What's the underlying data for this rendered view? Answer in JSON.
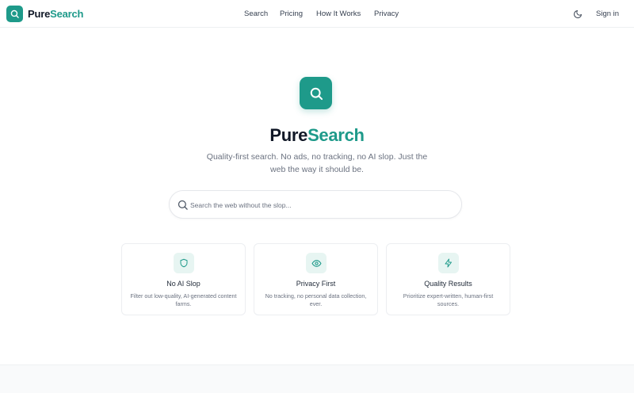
{
  "header": {
    "brand": {
      "pure": "Pure",
      "search": "Search"
    },
    "nav": [
      "Search",
      "Pricing",
      "How It Works",
      "Privacy"
    ],
    "signin_label": "Sign in",
    "theme_icon": "moon-icon"
  },
  "hero": {
    "title_pure": "Pure",
    "title_search": "Search",
    "subtitle": "Quality-first search. No ads, no tracking, no AI slop. Just the web the way it should be.",
    "icon": "search-icon"
  },
  "search": {
    "placeholder": "Search the web without the slop...",
    "value": ""
  },
  "features": [
    {
      "icon": "shield-icon",
      "title": "No AI Slop",
      "desc": "Filter out low-quality, AI-generated content farms."
    },
    {
      "icon": "eye-icon",
      "title": "Privacy First",
      "desc": "No tracking, no personal data collection, ever."
    },
    {
      "icon": "lightning-icon",
      "title": "Quality Results",
      "desc": "Prioritize expert-written, human-first sources."
    }
  ],
  "colors": {
    "accent": "#1e9a8a",
    "accent_light": "#e7f5f2",
    "text": "#111827",
    "muted": "#6b7280"
  }
}
